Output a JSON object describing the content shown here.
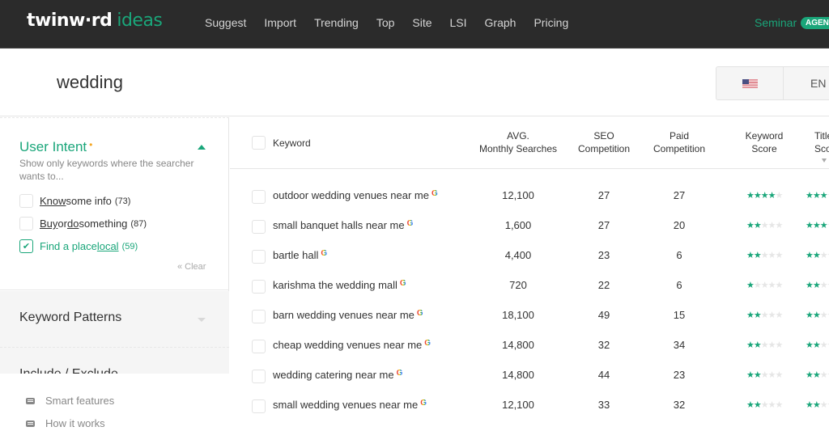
{
  "app": {
    "logo_main": "twinw·rd",
    "logo_sub": "ideas",
    "nav": [
      "Suggest",
      "Import",
      "Trending",
      "Top",
      "Site",
      "LSI",
      "Graph",
      "Pricing"
    ],
    "seminar_label": "Seminar",
    "agency_badge": "AGENC",
    "brand_color": "#1aa67a"
  },
  "search": {
    "query": "wedding",
    "country_flag": "us-flag-icon",
    "language": "EN"
  },
  "sidebar": {
    "user_intent": {
      "title": "User Intent",
      "required_marker": "•",
      "description": "Show only keywords where the searcher wants to...",
      "options": [
        {
          "pre": "",
          "u1": "Know",
          "mid": " some info",
          "u2": "",
          "post": "",
          "count": "(73)",
          "checked": false
        },
        {
          "pre": "",
          "u1": "Buy",
          "mid": " or ",
          "u2": "do",
          "post": " something",
          "count": "(87)",
          "checked": false
        },
        {
          "pre": "Find a place ",
          "u1": "",
          "mid": "",
          "u2": "local",
          "post": "",
          "count": "(59)",
          "checked": true
        }
      ],
      "clear_label": "« Clear"
    },
    "sections": [
      "Keyword Patterns",
      "Include / Exclude"
    ],
    "footer_links": [
      "Smart features",
      "How it works"
    ]
  },
  "table": {
    "headers": {
      "keyword": "Keyword",
      "avg_1": "AVG.",
      "avg_2": "Monthly Searches",
      "seo_1": "SEO",
      "seo_2": "Competition",
      "paid_1": "Paid",
      "paid_2": "Competition",
      "ks_1": "Keyword",
      "ks_2": "Score",
      "ts_1": "Title",
      "ts_2": "Score"
    },
    "rows": [
      {
        "keyword": "outdoor wedding venues near me",
        "searches": "12,100",
        "seo": "27",
        "paid": "27",
        "keyword_score": 4,
        "title_score": 3
      },
      {
        "keyword": "small banquet halls near me",
        "searches": "1,600",
        "seo": "27",
        "paid": "20",
        "keyword_score": 2,
        "title_score": 3
      },
      {
        "keyword": "bartle hall",
        "searches": "4,400",
        "seo": "23",
        "paid": "6",
        "keyword_score": 2,
        "title_score": 2
      },
      {
        "keyword": "karishma the wedding mall",
        "searches": "720",
        "seo": "22",
        "paid": "6",
        "keyword_score": 1,
        "title_score": 2
      },
      {
        "keyword": "barn wedding venues near me",
        "searches": "18,100",
        "seo": "49",
        "paid": "15",
        "keyword_score": 2,
        "title_score": 2
      },
      {
        "keyword": "cheap wedding venues near me",
        "searches": "14,800",
        "seo": "32",
        "paid": "34",
        "keyword_score": 2,
        "title_score": 2
      },
      {
        "keyword": "wedding catering near me",
        "searches": "14,800",
        "seo": "44",
        "paid": "23",
        "keyword_score": 2,
        "title_score": 2
      },
      {
        "keyword": "small wedding venues near me",
        "searches": "12,100",
        "seo": "33",
        "paid": "32",
        "keyword_score": 2,
        "title_score": 2
      }
    ],
    "google_icon_label": "G"
  }
}
